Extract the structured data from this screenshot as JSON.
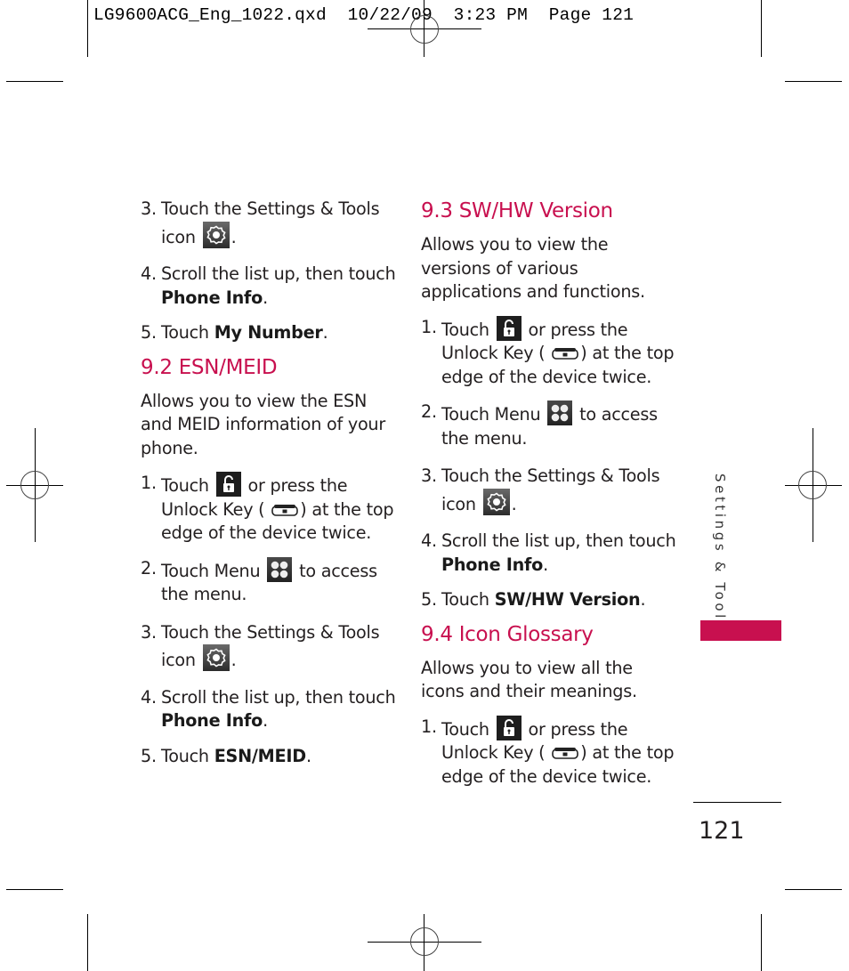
{
  "slug": {
    "text": "LG9600ACG_Eng_1022.qxd  10/22/09  3:23 PM  Page 121"
  },
  "left_column": {
    "intro_steps": [
      {
        "num": "3.",
        "parts": [
          "Touch the Settings & Tools icon",
          "."
        ],
        "icon": "gear-icon"
      },
      {
        "num": "4.",
        "text": "Scroll the list up, then touch",
        "bold": "Phone Info",
        "tail": "."
      },
      {
        "num": "5.",
        "text": "Touch",
        "bold": "My Number",
        "tail": "."
      }
    ],
    "section": {
      "heading": "9.2 ESN/MEID",
      "description": "Allows you to view the ESN and MEID information of your phone.",
      "steps": [
        {
          "num": "1.",
          "a": "Touch",
          "b": "or press the Unlock Key (",
          "c": ") at the top edge of the device twice."
        },
        {
          "num": "2.",
          "a": "Touch Menu",
          "b": "to access the menu."
        },
        {
          "num": "3.",
          "a": "Touch the Settings & Tools icon",
          "b": "."
        },
        {
          "num": "4.",
          "text": "Scroll the list up, then touch",
          "bold": "Phone Info",
          "tail": "."
        },
        {
          "num": "5.",
          "text": "Touch",
          "bold": "ESN/MEID",
          "tail": "."
        }
      ]
    }
  },
  "right_column": {
    "section_sw": {
      "heading": "9.3 SW/HW Version",
      "description": "Allows you to view the versions of various applications and functions.",
      "steps": [
        {
          "num": "1.",
          "a": "Touch",
          "b": "or press the Unlock Key (",
          "c": ") at the top edge of the device twice."
        },
        {
          "num": "2.",
          "a": "Touch Menu",
          "b": "to access the menu."
        },
        {
          "num": "3.",
          "a": "Touch the Settings & Tools icon",
          "b": "."
        },
        {
          "num": "4.",
          "text": "Scroll the list up, then touch",
          "bold": "Phone Info",
          "tail": "."
        },
        {
          "num": "5.",
          "text": "Touch",
          "bold": "SW/HW Version",
          "tail": "."
        }
      ]
    },
    "section_icons": {
      "heading": "9.4 Icon Glossary",
      "description": "Allows you to view all the icons and their meanings.",
      "steps": [
        {
          "num": "1.",
          "a": "Touch",
          "b": "or press the Unlock Key (",
          "c": ") at the top edge of the device twice."
        }
      ]
    }
  },
  "side_tab": {
    "label": "Settings & Tools",
    "color": "#c8104f"
  },
  "page_number": "121",
  "colors": {
    "heading": "#c8104f",
    "body_text": "#231f20"
  }
}
